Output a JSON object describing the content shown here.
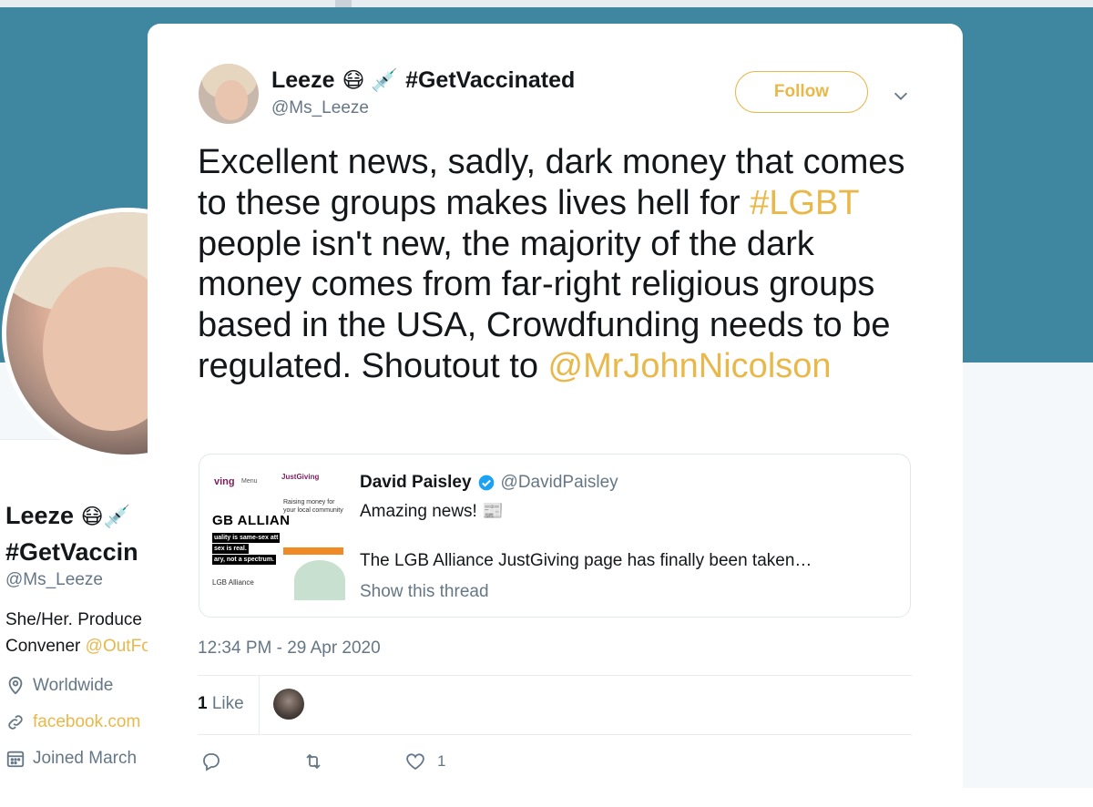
{
  "background_profile": {
    "name_line1": "Leeze",
    "name_emoji": "😷💉",
    "name_line2": "#GetVaccin",
    "handle": "@Ms_Leeze",
    "bio_line1": "She/Her. Produce",
    "bio_line2_prefix": "Convener ",
    "bio_line2_mention": "@OutFo",
    "location": "Worldwide",
    "website": "facebook.com",
    "joined": "Joined March",
    "banner_color": "#3f87a0",
    "accent_color": "#e8b84a"
  },
  "tweet": {
    "author_name": "Leeze",
    "author_emoji": "😷 💉",
    "author_hashtag": "#GetVaccinated",
    "author_handle": "@Ms_Leeze",
    "follow_label": "Follow",
    "text_part1": "Excellent news, sadly, dark money that comes to these groups makes lives hell for ",
    "text_hashtag": "#LGBT",
    "text_part2": " people isn't new, the majority of the dark money comes from far-right religious groups based in the USA, Crowdfunding needs to be regulated. Shoutout to ",
    "text_mention": "@MrJohnNicolson",
    "timestamp": "12:34 PM - 29 Apr 2020",
    "likes_number": "1",
    "likes_label": " Like",
    "like_action_count": "1",
    "accent_color": "#e8b84a"
  },
  "quoted_tweet": {
    "name": "David Paisley",
    "verified": true,
    "handle": "@DavidPaisley",
    "line1": "Amazing news! 📰",
    "line2": "The LGB Alliance JustGiving page has finally been taken…",
    "show_thread": "Show this thread",
    "thumbnail": {
      "brand_left": "ving",
      "menu_left": "Menu",
      "brand_right": "JustGiving",
      "headline": "Raising money for your local community",
      "logo": "GB ALLIAN",
      "tag1": "uality is same-sex att",
      "tag2": "sex is real.",
      "tag3": "ary, not a spectrum.",
      "footer": "LGB Alliance"
    }
  },
  "icons": [
    "chevron-down-icon",
    "verified-badge-icon",
    "reply-icon",
    "retweet-icon",
    "heart-icon",
    "location-icon",
    "link-icon",
    "calendar-icon"
  ]
}
